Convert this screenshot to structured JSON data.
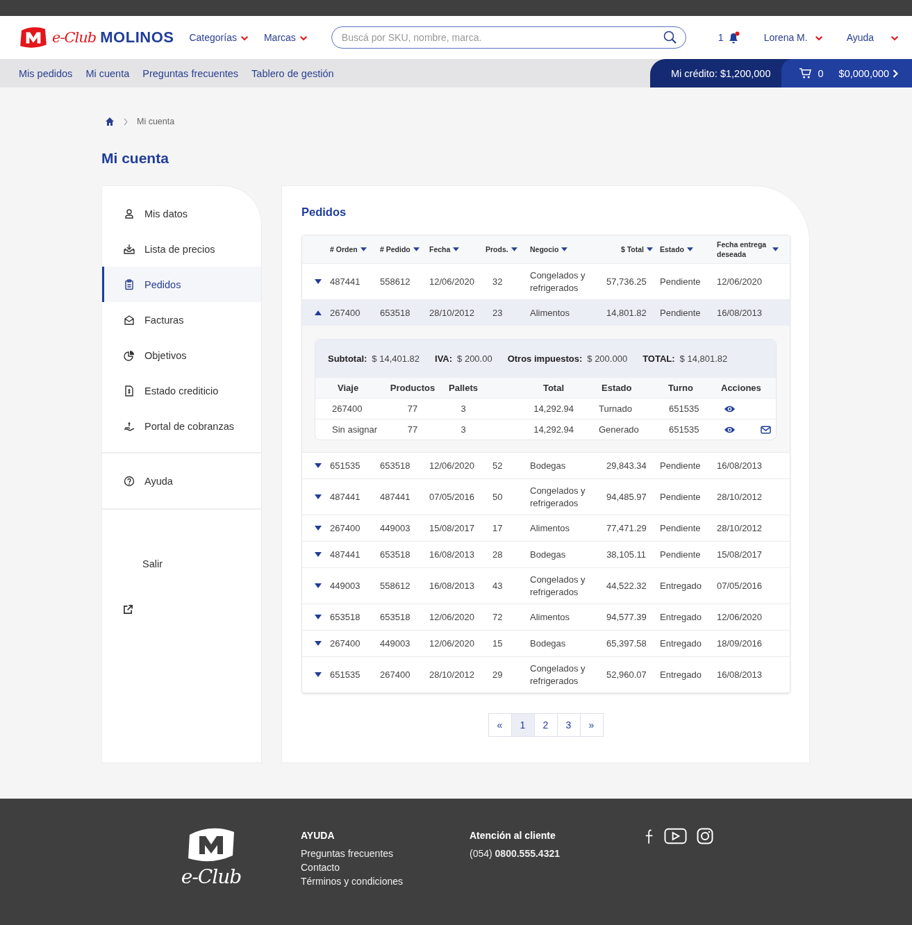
{
  "header": {
    "logo": {
      "script": "e-Club",
      "wordmark": "MOLINOS"
    },
    "menus": [
      {
        "label": "Categorías"
      },
      {
        "label": "Marcas"
      }
    ],
    "search": {
      "placeholder": "Buscá por SKU, nombre, marca."
    },
    "notifications": "1",
    "user_menu": "Lorena M.",
    "help_menu": "Ayuda"
  },
  "subnav": {
    "links": [
      "Mis pedidos",
      "Mi cuenta",
      "Preguntas frecuentes",
      "Tablero de gestión"
    ],
    "credit": "Mi crédito: $1,200,000",
    "cart_count": "0",
    "cart_total": "$0,000,000"
  },
  "breadcrumb": [
    "Mi cuenta"
  ],
  "page_title": "Mi cuenta",
  "sidebar": {
    "items": [
      {
        "label": "Mis datos",
        "selected": false
      },
      {
        "label": "Lista de precios",
        "selected": false
      },
      {
        "label": "Pedidos",
        "selected": true
      },
      {
        "label": "Facturas",
        "selected": false
      },
      {
        "label": "Objetivos",
        "selected": false
      },
      {
        "label": "Estado crediticio",
        "selected": false
      },
      {
        "label": "Portal de cobranzas",
        "selected": false
      }
    ],
    "help": "Ayuda",
    "logout": "Salir"
  },
  "orders": {
    "title": "Pedidos",
    "columns": [
      "# Orden",
      "# Pedido",
      "Fecha",
      "Prods.",
      "Negocio",
      "$ Total",
      "Estado",
      "Fecha entrega deseada"
    ],
    "rows": [
      {
        "cells": [
          "487441",
          "558612",
          "12/06/2020",
          "32",
          "Congelados y refrigerados",
          "57,736.25",
          "Pendiente",
          "12/06/2020"
        ],
        "expanded": false
      },
      {
        "cells": [
          "267400",
          "653518",
          "28/10/2012",
          "23",
          "Alimentos",
          "14,801.82",
          "Pendiente",
          "16/08/2013"
        ],
        "expanded": true,
        "detail": {
          "summary": [
            {
              "label": "Subtotal:",
              "value": "$ 14,401.82"
            },
            {
              "label": "IVA:",
              "value": "$ 200.00"
            },
            {
              "label": "Otros impuestos:",
              "value": "$ 200.000"
            },
            {
              "label": "TOTAL:",
              "value": "$ 14,801.82"
            }
          ],
          "columns": [
            "Viaje",
            "Productos",
            "Pallets",
            "Total",
            "Estado",
            "Turno",
            "Acciones"
          ],
          "trips": [
            {
              "cells": [
                "267400",
                "77",
                "3",
                "14,292.94",
                "Turnado",
                "651535"
              ],
              "actions": [
                {
                  "kind": "view"
                }
              ]
            },
            {
              "cells": [
                "Sin asignar",
                "77",
                "3",
                "14,292.94",
                "Generado",
                "651535"
              ],
              "actions": [
                {
                  "kind": "view"
                },
                {
                  "kind": "mail"
                }
              ]
            }
          ]
        }
      },
      {
        "cells": [
          "651535",
          "653518",
          "12/06/2020",
          "52",
          "Bodegas",
          "29,843.34",
          "Pendiente",
          "16/08/2013"
        ],
        "expanded": false
      },
      {
        "cells": [
          "487441",
          "487441",
          "07/05/2016",
          "50",
          "Congelados y refrigerados",
          "94,485.97",
          "Pendiente",
          "28/10/2012"
        ],
        "expanded": false
      },
      {
        "cells": [
          "267400",
          "449003",
          "15/08/2017",
          "17",
          "Alimentos",
          "77,471.29",
          "Pendiente",
          "28/10/2012"
        ],
        "expanded": false
      },
      {
        "cells": [
          "487441",
          "653518",
          "16/08/2013",
          "28",
          "Bodegas",
          "38,105.11",
          "Pendiente",
          "15/08/2017"
        ],
        "expanded": false
      },
      {
        "cells": [
          "449003",
          "558612",
          "16/08/2013",
          "43",
          "Congelados y refrigerados",
          "44,522.32",
          "Entregado",
          "07/05/2016"
        ],
        "expanded": false
      },
      {
        "cells": [
          "653518",
          "653518",
          "12/06/2020",
          "72",
          "Alimentos",
          "94,577.39",
          "Entregado",
          "12/06/2020"
        ],
        "expanded": false
      },
      {
        "cells": [
          "267400",
          "449003",
          "12/06/2020",
          "15",
          "Bodegas",
          "65,397.58",
          "Entregado",
          "18/09/2016"
        ],
        "expanded": false
      },
      {
        "cells": [
          "651535",
          "267400",
          "28/10/2012",
          "29",
          "Congelados y refrigerados",
          "52,960.07",
          "Entregado",
          "16/08/2013"
        ],
        "expanded": false
      }
    ]
  },
  "pagination": {
    "prev": "«",
    "pages": [
      {
        "label": "1",
        "selected": true
      },
      {
        "label": "2",
        "selected": false
      },
      {
        "label": "3",
        "selected": false
      }
    ],
    "next": "»"
  },
  "footer": {
    "logo_text": "e-Club",
    "help_title": "AYUDA",
    "help_links": [
      "Preguntas frecuentes",
      "Contacto",
      "Términos y condiciones"
    ],
    "contact_title": "Atención al cliente",
    "phone": "(054) **0800.555.4321**"
  }
}
